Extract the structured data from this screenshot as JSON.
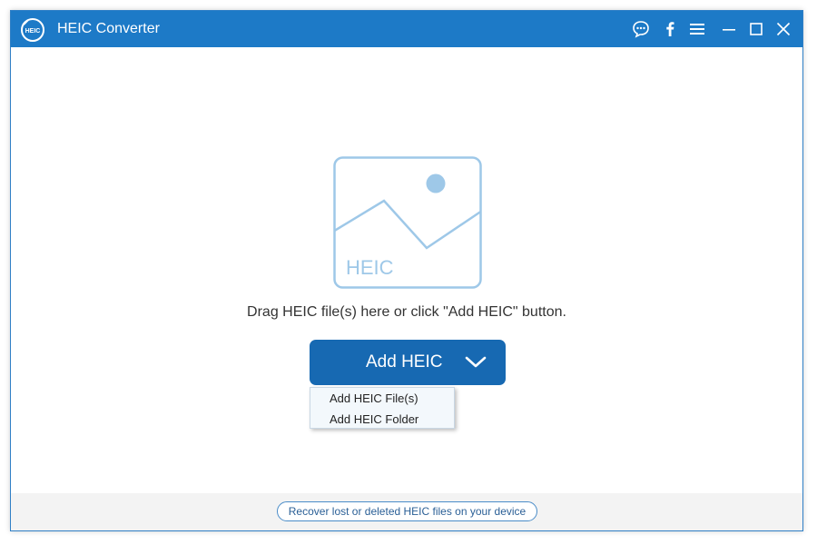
{
  "window": {
    "title": "HEIC Converter",
    "logo_text": "HEIC"
  },
  "titlebar": {
    "icons": [
      "chat-icon",
      "facebook-icon",
      "menu-icon",
      "minimize-icon",
      "maximize-icon",
      "close-icon"
    ]
  },
  "main": {
    "placeholder_label": "HEIC",
    "hint": "Drag HEIC file(s) here or click \"Add HEIC\" button.",
    "add_button_label": "Add HEIC",
    "dropdown": {
      "items": [
        "Add HEIC File(s)",
        "Add HEIC Folder"
      ]
    }
  },
  "footer": {
    "recover_link": "Recover lost or deleted HEIC files on your device"
  },
  "colors": {
    "titlebar": "#1d7ac7",
    "button": "#1769b2",
    "placeholder_accent": "#9ec8e8"
  }
}
